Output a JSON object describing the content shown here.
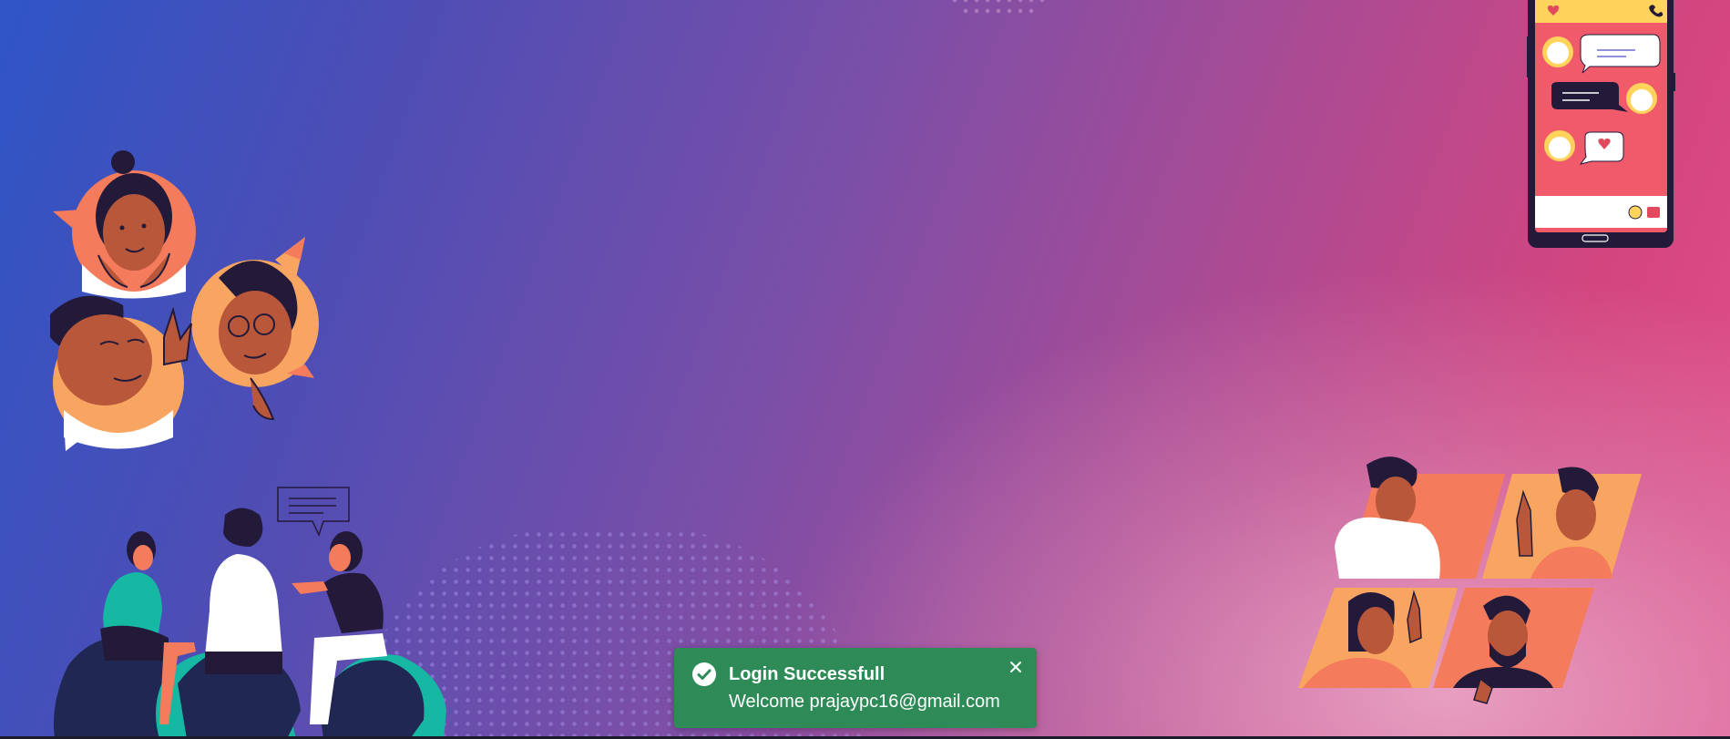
{
  "toast": {
    "title": "Login Successfull",
    "message": "Welcome prajaypc16@gmail.com",
    "status": "success",
    "color": "#2e8b57",
    "icon": "check-circle-icon",
    "close_icon": "close-icon"
  },
  "background": {
    "gradient_colors": [
      "#2f55c6",
      "#7a4fa8",
      "#d3457f"
    ]
  },
  "illustrations": [
    "people-avatars-bubbles",
    "friends-chatting-on-beanbags",
    "phone-chat-app",
    "video-call-grid"
  ]
}
